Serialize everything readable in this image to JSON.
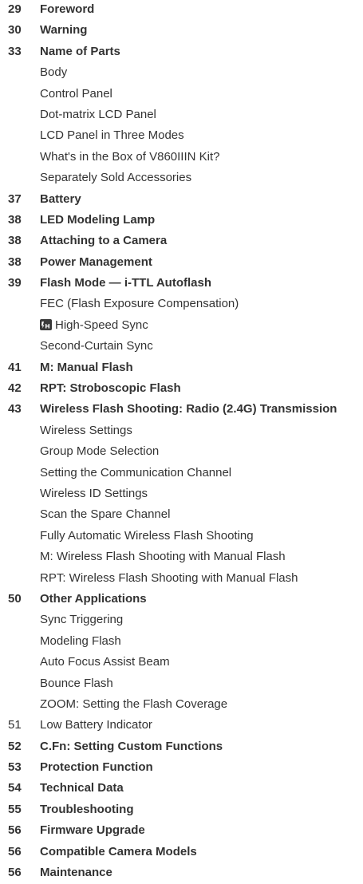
{
  "entries": [
    {
      "page": "29",
      "title": "Foreword",
      "level": 0
    },
    {
      "page": "30",
      "title": "Warning",
      "level": 0
    },
    {
      "page": "33",
      "title": "Name of Parts",
      "level": 0
    },
    {
      "page": "",
      "title": "Body",
      "level": 1
    },
    {
      "page": "",
      "title": "Control Panel",
      "level": 1
    },
    {
      "page": "",
      "title": "Dot-matrix LCD Panel",
      "level": 1
    },
    {
      "page": "",
      "title": "LCD Panel in Three Modes",
      "level": 1
    },
    {
      "page": "",
      "title": "What's in the Box of V860IIIN Kit?",
      "level": 1
    },
    {
      "page": "",
      "title": "Separately Sold Accessories",
      "level": 1
    },
    {
      "page": "37",
      "title": "Battery",
      "level": 0
    },
    {
      "page": "38",
      "title": "LED Modeling Lamp",
      "level": 0
    },
    {
      "page": "38",
      "title": "Attaching to a Camera",
      "level": 0
    },
    {
      "page": "38",
      "title": "Power Management",
      "level": 0
    },
    {
      "page": "39",
      "title": "Flash Mode — i-TTL Autoflash",
      "level": 0
    },
    {
      "page": "",
      "title": "FEC (Flash Exposure Compensation)",
      "level": 1
    },
    {
      "page": "",
      "title": "High-Speed Sync",
      "level": 1,
      "icon": "high-speed-sync-icon"
    },
    {
      "page": "",
      "title": "Second-Curtain Sync",
      "level": 1
    },
    {
      "page": "41",
      "title": "M: Manual Flash",
      "level": 0
    },
    {
      "page": "42",
      "title": "RPT: Stroboscopic Flash",
      "level": 0
    },
    {
      "page": "43",
      "title": "Wireless Flash Shooting: Radio (2.4G) Transmission",
      "level": 0
    },
    {
      "page": "",
      "title": "Wireless Settings",
      "level": 1
    },
    {
      "page": "",
      "title": "Group Mode Selection",
      "level": 1
    },
    {
      "page": "",
      "title": "Setting the Communication Channel",
      "level": 1
    },
    {
      "page": "",
      "title": "Wireless ID Settings",
      "level": 1
    },
    {
      "page": "",
      "title": "Scan the Spare Channel",
      "level": 1
    },
    {
      "page": "",
      "title": "Fully Automatic Wireless Flash Shooting",
      "level": 1
    },
    {
      "page": "",
      "title": "M: Wireless Flash Shooting with Manual Flash",
      "level": 1
    },
    {
      "page": "",
      "title": "RPT: Wireless Flash Shooting with Manual Flash",
      "level": 1
    },
    {
      "page": "50",
      "title": "Other Applications",
      "level": 0
    },
    {
      "page": "",
      "title": "Sync Triggering",
      "level": 1
    },
    {
      "page": "",
      "title": "Modeling Flash",
      "level": 1
    },
    {
      "page": "",
      "title": "Auto Focus Assist Beam",
      "level": 1
    },
    {
      "page": "",
      "title": "Bounce Flash",
      "level": 1
    },
    {
      "page": "",
      "title": "ZOOM: Setting the Flash Coverage",
      "level": 1
    },
    {
      "page": "51",
      "title": "Low Battery Indicator",
      "level": 0,
      "weight": "normal"
    },
    {
      "page": "52",
      "title": "C.Fn: Setting Custom Functions",
      "level": 0
    },
    {
      "page": "53",
      "title": "Protection Function",
      "level": 0
    },
    {
      "page": "54",
      "title": "Technical Data",
      "level": 0
    },
    {
      "page": "55",
      "title": "Troubleshooting",
      "level": 0
    },
    {
      "page": "56",
      "title": "Firmware Upgrade",
      "level": 0
    },
    {
      "page": "56",
      "title": "Compatible Camera Models",
      "level": 0
    },
    {
      "page": "56",
      "title": "Maintenance",
      "level": 0
    }
  ],
  "colors": {
    "text": "#333333",
    "icon": "#3a3a3a"
  }
}
